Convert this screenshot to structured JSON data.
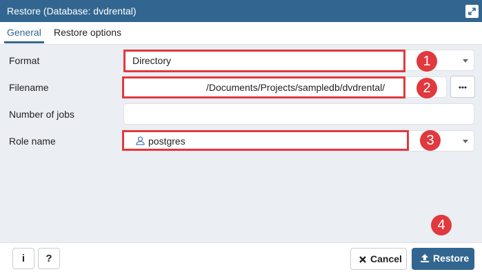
{
  "window": {
    "title": "Restore (Database: dvdrental)"
  },
  "tabs": [
    {
      "label": "General",
      "active": true
    },
    {
      "label": "Restore options",
      "active": false
    }
  ],
  "form": {
    "format": {
      "label": "Format",
      "value": "Directory"
    },
    "filename": {
      "label": "Filename",
      "value": "/Documents/Projects/sampledb/dvdrental/"
    },
    "jobs": {
      "label": "Number of jobs",
      "value": ""
    },
    "role": {
      "label": "Role name",
      "value": "postgres"
    }
  },
  "badges": [
    "1",
    "2",
    "3",
    "4"
  ],
  "footer": {
    "info_label": "i",
    "help_label": "?",
    "cancel_label": "Cancel",
    "restore_label": "Restore"
  },
  "colors": {
    "primary": "#326690",
    "highlight": "#e0393e",
    "panel": "#ebeef3"
  }
}
